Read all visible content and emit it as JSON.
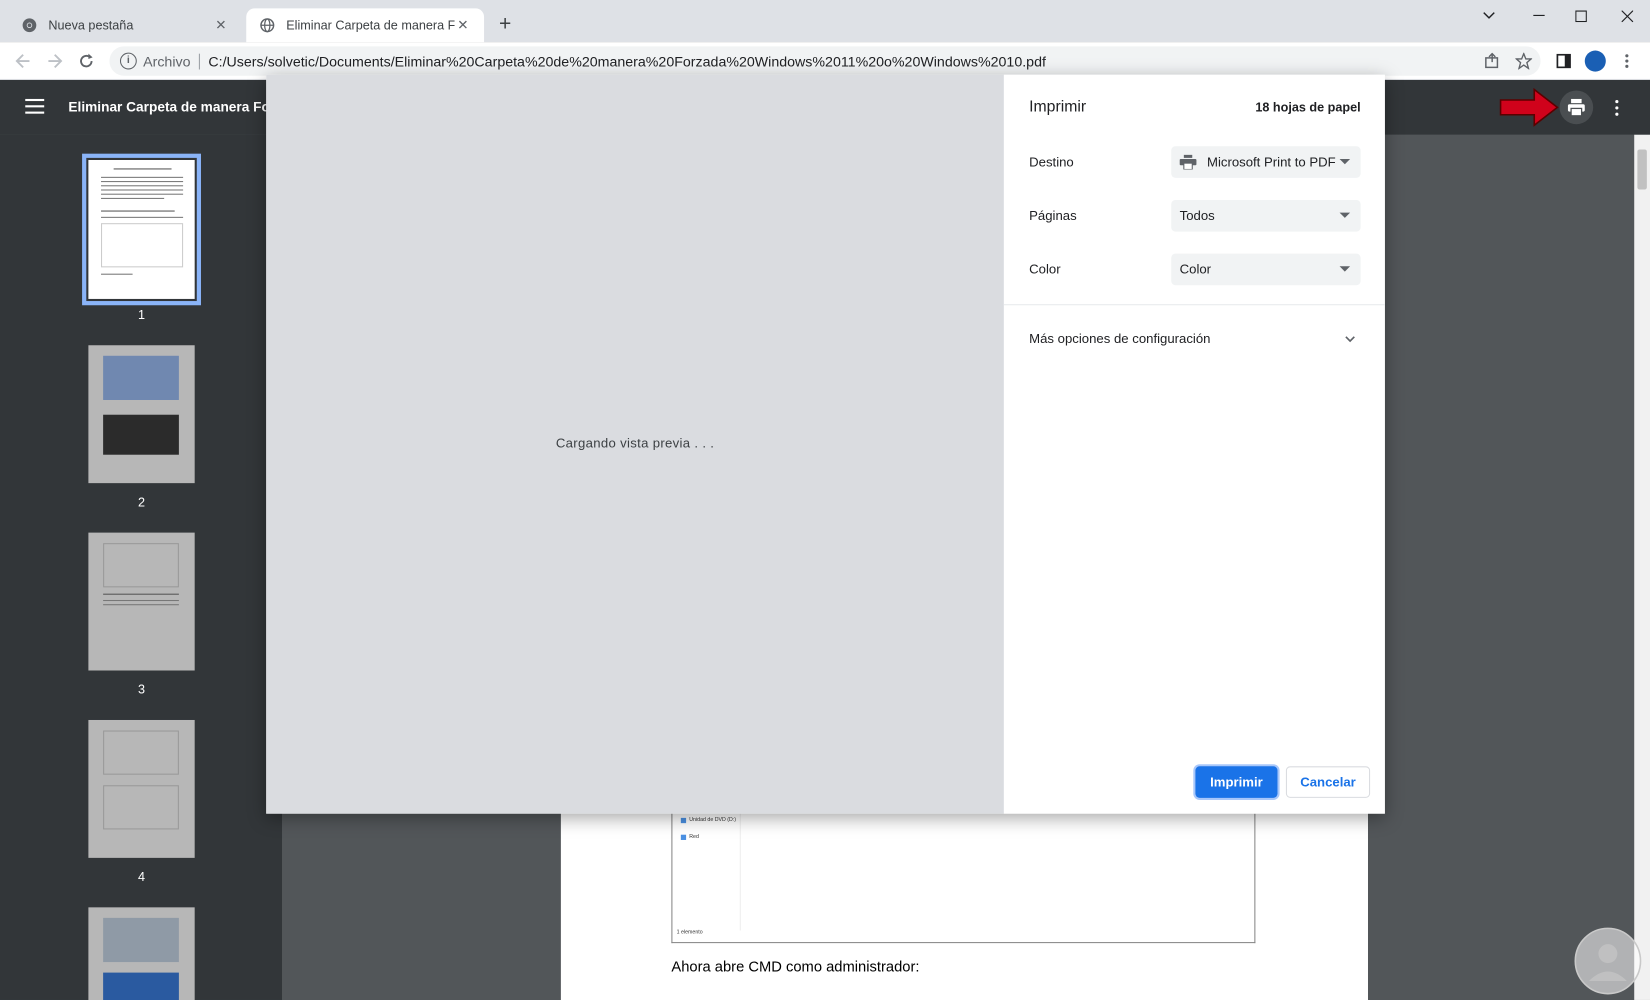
{
  "browser": {
    "tabs": [
      {
        "title": "Nueva pestaña",
        "icon": "chrome-icon"
      },
      {
        "title": "Eliminar Carpeta de manera Forz",
        "icon": "globe-icon"
      }
    ],
    "omnibox": {
      "scheme": "Archivo",
      "url": "C:/Users/solvetic/Documents/Eliminar%20Carpeta%20de%20manera%20Forzada%20Windows%2011%20o%20Windows%2010.pdf"
    }
  },
  "pdf_viewer": {
    "title": "Eliminar Carpeta de manera Forz",
    "thumbnails": [
      "1",
      "2",
      "3",
      "4"
    ],
    "page_text": "Ahora abre CMD como administrador:",
    "explorer_items": [
      "Unidad de DVD (D:)",
      "Red"
    ],
    "explorer_status": "1 elemento"
  },
  "print_dialog": {
    "title": "Imprimir",
    "sheets": "18 hojas de papel",
    "loading": "Cargando vista previa . . .",
    "destination_label": "Destino",
    "destination_value": "Microsoft Print to PDF",
    "pages_label": "Páginas",
    "pages_value": "Todos",
    "color_label": "Color",
    "color_value": "Color",
    "more_options": "Más opciones de configuración",
    "print_button": "Imprimir",
    "cancel_button": "Cancelar"
  },
  "colors": {
    "accent": "#1a73e8",
    "annotation_arrow": "#d0021b"
  }
}
